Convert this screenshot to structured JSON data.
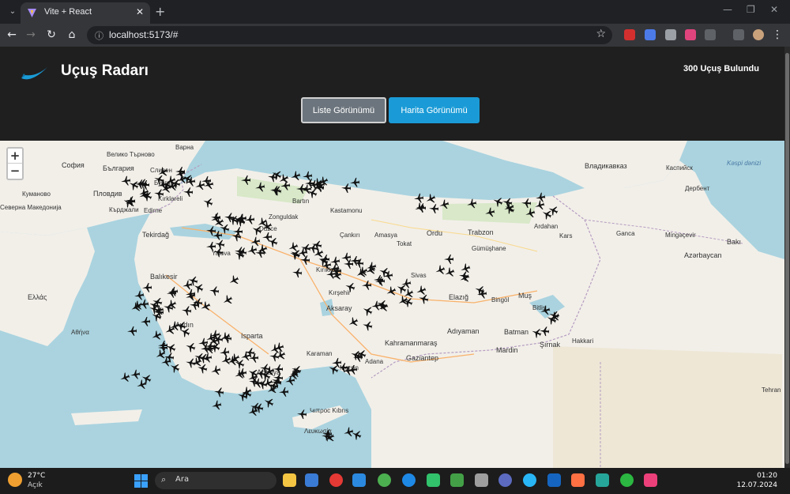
{
  "browser": {
    "tab_title": "Vite + React",
    "url": "localhost:5173/#"
  },
  "app": {
    "title": "Uçuş Radarı",
    "flight_count": "300 Uçuş Bulundu",
    "list_view_label": "Liste Görünümü",
    "map_view_label": "Harita Görünümü"
  },
  "map": {
    "zoom_in": "+",
    "zoom_out": "−",
    "labels": [
      {
        "text": "Варна"
      },
      {
        "text": "Велико Търново"
      },
      {
        "text": "България"
      },
      {
        "text": "София"
      },
      {
        "text": "Сливен"
      },
      {
        "text": "Бургас"
      },
      {
        "text": "Кумaново"
      },
      {
        "text": "Пловдив"
      },
      {
        "text": "Северна Македонија"
      },
      {
        "text": "Kırklareli"
      },
      {
        "text": "Edirne"
      },
      {
        "text": "Кърджали"
      },
      {
        "text": "Tekirdağ"
      },
      {
        "text": "Yalova"
      },
      {
        "text": "Balıkesir"
      },
      {
        "text": "Aydın"
      },
      {
        "text": "Isparta"
      },
      {
        "text": "Antalya"
      },
      {
        "text": "Bartın"
      },
      {
        "text": "Kastamonu"
      },
      {
        "text": "Zonguldak"
      },
      {
        "text": "Düzce"
      },
      {
        "text": "Çankırı"
      },
      {
        "text": "Amasya"
      },
      {
        "text": "Tokat"
      },
      {
        "text": "Ordu"
      },
      {
        "text": "Trabzon"
      },
      {
        "text": "Gümüşhane"
      },
      {
        "text": "Kırıkkale"
      },
      {
        "text": "Kırşehir"
      },
      {
        "text": "Sivas"
      },
      {
        "text": "Elazığ"
      },
      {
        "text": "Bingöl"
      },
      {
        "text": "Muş"
      },
      {
        "text": "Bitlis"
      },
      {
        "text": "Batman"
      },
      {
        "text": "Şırnak"
      },
      {
        "text": "Hakkari"
      },
      {
        "text": "Mardin"
      },
      {
        "text": "Adıyaman"
      },
      {
        "text": "Kahramanmaraş"
      },
      {
        "text": "Gaziantep"
      },
      {
        "text": "Adana"
      },
      {
        "text": "Karaman"
      },
      {
        "text": "Mersin"
      },
      {
        "text": "Aksaray"
      },
      {
        "text": "Ardahan"
      },
      {
        "text": "Kars"
      },
      {
        "text": "Владикавказ"
      },
      {
        "text": "Каспийск"
      },
      {
        "text": "Дербент"
      },
      {
        "text": "Ganca"
      },
      {
        "text": "Mingəçevir"
      },
      {
        "text": "Bakı"
      },
      {
        "text": "Azərbaycan"
      },
      {
        "text": "Կιπροс Kıbrıs"
      },
      {
        "text": "Λευκωσία"
      },
      {
        "text": "Ελλάς"
      },
      {
        "text": "Αθήνα"
      },
      {
        "text": "Kəspi dənizi"
      },
      {
        "text": "Tehran"
      }
    ]
  },
  "taskbar": {
    "temp": "27°C",
    "weather": "Açık",
    "search_placeholder": "Ara",
    "time": "01:20",
    "date": "12.07.2024"
  }
}
